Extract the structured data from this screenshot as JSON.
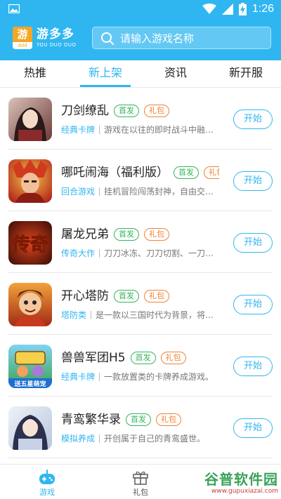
{
  "status_bar": {
    "time": "1:26",
    "icons": [
      "image-icon",
      "wifi-icon",
      "signal-icon",
      "battery-icon"
    ]
  },
  "header": {
    "logo_text": "游",
    "logo_sub": "ddd",
    "brand_name": "游多多",
    "brand_sub": "YOU DUO DUO",
    "search_placeholder": "请输入游戏名称",
    "accent": "#2fb6f1"
  },
  "tabs": [
    {
      "label": "热推",
      "active": false
    },
    {
      "label": "新上架",
      "active": true
    },
    {
      "label": "资讯",
      "active": false
    },
    {
      "label": "新开服",
      "active": false
    }
  ],
  "badges": {
    "first": "首发",
    "gift": "礼包",
    "first_color": "#36b35c",
    "gift_color": "#f08238"
  },
  "start_label": "开始",
  "games": [
    {
      "title": "刀剑缭乱",
      "category": "经典卡牌",
      "desc": "游戏在以往的即时战斗中融…",
      "gift_partial": false
    },
    {
      "title": "哪吒闹海（福利版）",
      "category": "回合游戏",
      "desc": "挂机冒险闯荡封神，自由交…",
      "gift_partial": true
    },
    {
      "title": "屠龙兄弟",
      "category": "传奇大作",
      "desc": "刀刀冰冻、刀刀切割、一刀…",
      "gift_partial": false
    },
    {
      "title": "开心塔防",
      "category": "塔防类",
      "desc": "是一款以三国时代为背景，将…",
      "gift_partial": false
    },
    {
      "title": "兽兽军团H5",
      "category": "经典卡牌",
      "desc": "一款放置类的卡牌养成游戏。",
      "gift_partial": false
    },
    {
      "title": "青鸾繁华录",
      "category": "模拟养成",
      "desc": "开创属于自己的青鸾盛世。",
      "gift_partial": false
    }
  ],
  "thumb_texts": {
    "game3": "传奇",
    "game5": "送五星萌宠"
  },
  "bottom_nav": [
    {
      "label": "游戏",
      "icon": "gamepad-icon",
      "active": true
    },
    {
      "label": "礼包",
      "icon": "gift-box-icon",
      "active": false
    }
  ],
  "watermark": {
    "main": "谷普软件园",
    "url": "www.gupuxiazai.com"
  }
}
